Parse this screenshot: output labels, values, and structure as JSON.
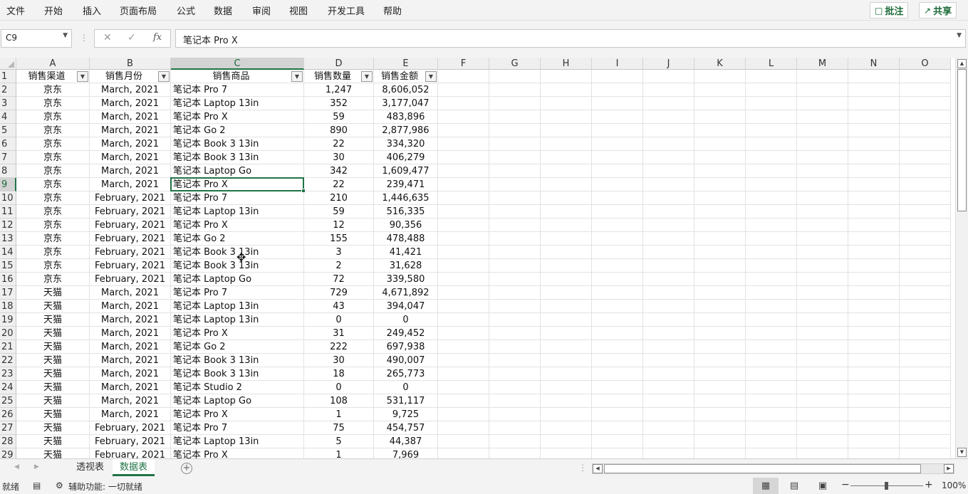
{
  "ribbon": {
    "tabs": [
      "文件",
      "开始",
      "插入",
      "页面布局",
      "公式",
      "数据",
      "审阅",
      "视图",
      "开发工具",
      "帮助"
    ],
    "comments_label": "批注",
    "share_label": "共享"
  },
  "formula_bar": {
    "name_box": "C9",
    "fx_label": "fx",
    "content": "笔记本 Pro X"
  },
  "columns": [
    "A",
    "B",
    "C",
    "D",
    "E",
    "F",
    "G",
    "H",
    "I",
    "J",
    "K",
    "L",
    "M",
    "N",
    "O"
  ],
  "selected_column": "C",
  "selected_row": 9,
  "header_row": [
    "销售渠道",
    "销售月份",
    "销售商品",
    "销售数量",
    "销售金额"
  ],
  "rows": [
    [
      "京东",
      "March, 2021",
      "笔记本 Pro 7",
      "1,247",
      "8,606,052"
    ],
    [
      "京东",
      "March, 2021",
      "笔记本 Laptop 13in",
      "352",
      "3,177,047"
    ],
    [
      "京东",
      "March, 2021",
      "笔记本 Pro X",
      "59",
      "483,896"
    ],
    [
      "京东",
      "March, 2021",
      "笔记本 Go 2",
      "890",
      "2,877,986"
    ],
    [
      "京东",
      "March, 2021",
      "笔记本 Book 3 13in",
      "22",
      "334,320"
    ],
    [
      "京东",
      "March, 2021",
      "笔记本 Book 3 13in",
      "30",
      "406,279"
    ],
    [
      "京东",
      "March, 2021",
      "笔记本 Laptop Go",
      "342",
      "1,609,477"
    ],
    [
      "京东",
      "March, 2021",
      "笔记本 Pro X",
      "22",
      "239,471"
    ],
    [
      "京东",
      "February, 2021",
      "笔记本 Pro 7",
      "210",
      "1,446,635"
    ],
    [
      "京东",
      "February, 2021",
      "笔记本 Laptop 13in",
      "59",
      "516,335"
    ],
    [
      "京东",
      "February, 2021",
      "笔记本 Pro X",
      "12",
      "90,356"
    ],
    [
      "京东",
      "February, 2021",
      "笔记本 Go 2",
      "155",
      "478,488"
    ],
    [
      "京东",
      "February, 2021",
      "笔记本 Book 3 13in",
      "3",
      "41,421"
    ],
    [
      "京东",
      "February, 2021",
      "笔记本 Book 3 13in",
      "2",
      "31,628"
    ],
    [
      "京东",
      "February, 2021",
      "笔记本 Laptop Go",
      "72",
      "339,580"
    ],
    [
      "天猫",
      "March, 2021",
      "笔记本 Pro 7",
      "729",
      "4,671,892"
    ],
    [
      "天猫",
      "March, 2021",
      "笔记本 Laptop 13in",
      "43",
      "394,047"
    ],
    [
      "天猫",
      "March, 2021",
      "笔记本 Laptop 13in",
      "0",
      "0"
    ],
    [
      "天猫",
      "March, 2021",
      "笔记本 Pro X",
      "31",
      "249,452"
    ],
    [
      "天猫",
      "March, 2021",
      "笔记本 Go 2",
      "222",
      "697,938"
    ],
    [
      "天猫",
      "March, 2021",
      "笔记本 Book 3 13in",
      "30",
      "490,007"
    ],
    [
      "天猫",
      "March, 2021",
      "笔记本 Book 3 13in",
      "18",
      "265,773"
    ],
    [
      "天猫",
      "March, 2021",
      "笔记本 Studio 2",
      "0",
      "0"
    ],
    [
      "天猫",
      "March, 2021",
      "笔记本 Laptop Go",
      "108",
      "531,117"
    ],
    [
      "天猫",
      "March, 2021",
      "笔记本 Pro X",
      "1",
      "9,725"
    ],
    [
      "天猫",
      "February, 2021",
      "笔记本 Pro 7",
      "75",
      "454,757"
    ],
    [
      "天猫",
      "February, 2021",
      "笔记本 Laptop 13in",
      "5",
      "44,387"
    ],
    [
      "天猫",
      "February, 2021",
      "笔记本 Pro X",
      "1",
      "7,969"
    ]
  ],
  "sheet_tabs": [
    "透视表",
    "数据表"
  ],
  "active_sheet": "数据表",
  "status": {
    "ready": "就绪",
    "accessibility": "辅助功能: 一切就绪",
    "zoom": "100%"
  },
  "colors": {
    "accent": "#217346",
    "ribbon_bg": "#f3f3f3"
  }
}
